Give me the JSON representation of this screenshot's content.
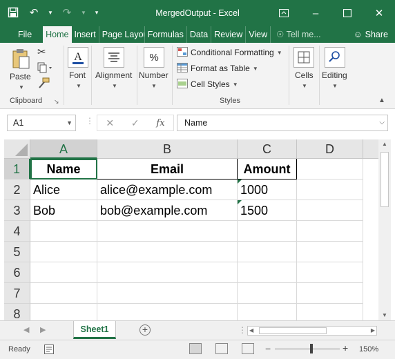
{
  "window": {
    "title": "MergedOutput  -  Excel"
  },
  "ribbon_tabs": [
    {
      "label": "File"
    },
    {
      "label": "Home"
    },
    {
      "label": "Insert"
    },
    {
      "label": "Page Layou"
    },
    {
      "label": "Formulas"
    },
    {
      "label": "Data"
    },
    {
      "label": "Review"
    },
    {
      "label": "View"
    }
  ],
  "tell_me": "Tell me...",
  "share": "Share",
  "ribbon": {
    "clipboard": {
      "paste": "Paste",
      "group": "Clipboard"
    },
    "font": {
      "label": "Font"
    },
    "alignment": {
      "label": "Alignment"
    },
    "number": {
      "label": "Number"
    },
    "styles": {
      "conditional": "Conditional Formatting",
      "format_table": "Format as Table",
      "cell_styles": "Cell Styles",
      "group": "Styles"
    },
    "cells": {
      "label": "Cells"
    },
    "editing": {
      "label": "Editing"
    }
  },
  "formula_bar": {
    "name_box": "A1",
    "fx": "fx",
    "value": "Name"
  },
  "columns": [
    "A",
    "B",
    "C",
    "D"
  ],
  "rows": [
    "1",
    "2",
    "3",
    "4",
    "5",
    "6",
    "7",
    "8"
  ],
  "table": {
    "headers": [
      "Name",
      "Email",
      "Amount"
    ],
    "data": [
      [
        "Alice",
        "alice@example.com",
        "1000"
      ],
      [
        "Bob",
        "bob@example.com",
        "1500"
      ]
    ]
  },
  "sheets": [
    {
      "name": "Sheet1"
    }
  ],
  "status": {
    "ready": "Ready",
    "zoom": "150%"
  },
  "colors": {
    "accent": "#217346"
  }
}
